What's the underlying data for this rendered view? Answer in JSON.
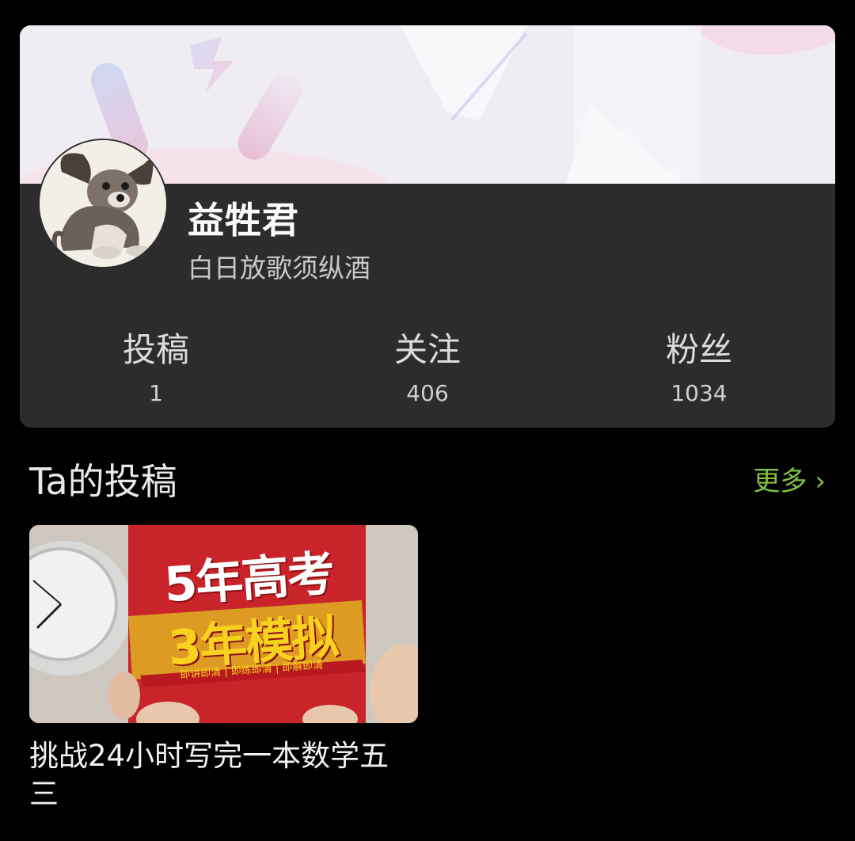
{
  "profile": {
    "name": "益牲君",
    "bio": "白日放歌须纵酒",
    "avatar_icon": "dog-avatar"
  },
  "stats": [
    {
      "label": "投稿",
      "value": "1"
    },
    {
      "label": "关注",
      "value": "406"
    },
    {
      "label": "粉丝",
      "value": "1034"
    }
  ],
  "posts_section": {
    "title": "Ta的投稿",
    "more_label": "更多",
    "more_icon": "chevron-right-icon"
  },
  "posts": [
    {
      "title": "挑战24小时写完一本数学五三",
      "thumb_text": {
        "line1": "5年高考",
        "line2": "3年模拟",
        "strip": "即讲即清 | 即练即清 | 即解即清"
      }
    }
  ],
  "colors": {
    "background": "#000000",
    "card": "#2c2c2c",
    "accent_green": "#7fc244"
  }
}
